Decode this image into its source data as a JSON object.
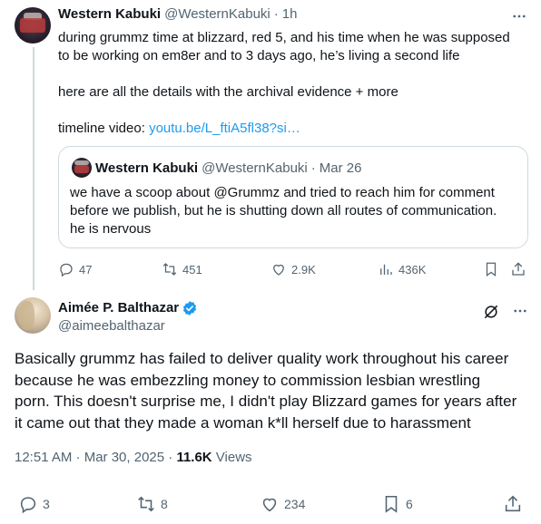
{
  "tweet1": {
    "name": "Western Kabuki",
    "handle": "@WesternKabuki",
    "separator": "·",
    "time": "1h",
    "lines": [
      "during grummz time at blizzard, red 5, and his time when he was supposed",
      "to be working on em8er and to 3 days ago, he’s living a second life"
    ],
    "line2": "here are all the details with the archival evidence + more",
    "line3_prefix": "timeline video: ",
    "link": "youtu.be/L_ftiA5fl38?si…",
    "quote": {
      "name": "Western Kabuki",
      "handle": "@WesternKabuki",
      "separator": "·",
      "date": "Mar 26",
      "lines": [
        "we have a scoop about @Grummz and tried to reach him for comment",
        "before we publish, but he is shutting down all routes of communication.",
        "he is nervous"
      ]
    },
    "actions": {
      "replies": "47",
      "reposts": "451",
      "likes": "2.9K",
      "views": "436K"
    }
  },
  "tweet2": {
    "name": "Aimée P. Balthazar",
    "handle": "@aimeebalthazar",
    "lines": [
      "Basically grummz has failed to deliver quality work throughout his career",
      "because he was embezzling money to commission lesbian wrestling",
      "porn. This doesn't surprise me, I didn't play Blizzard games for years after",
      "it came out that they made a woman k*ll herself due to harassment"
    ],
    "timestamp": "12:51 AM · Mar 30, 2025 · ",
    "views_count": "11.6K",
    "views_label": " Views",
    "actions": {
      "replies": "3",
      "reposts": "8",
      "likes": "234",
      "bookmarks": "6"
    }
  },
  "colors": {
    "text": "#0f1419",
    "secondary": "#536471",
    "link": "#1d9bf0",
    "verified": "#1d9bf0",
    "border": "#cfd9de"
  }
}
